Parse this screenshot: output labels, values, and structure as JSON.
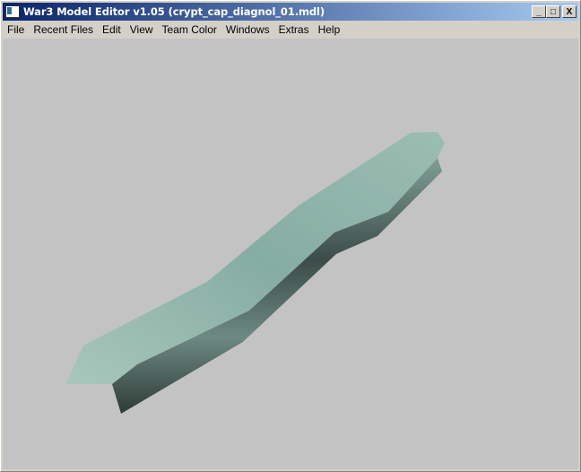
{
  "window": {
    "title": "War3 Model Editor v1.05 (crypt_cap_diagnol_01.mdl)"
  },
  "title_controls": {
    "minimize": "_",
    "maximize": "□",
    "close": "X"
  },
  "menu": [
    {
      "label": "File"
    },
    {
      "label": "Recent Files"
    },
    {
      "label": "Edit"
    },
    {
      "label": "View"
    },
    {
      "label": "Team Color"
    },
    {
      "label": "Windows"
    },
    {
      "label": "Extras"
    },
    {
      "label": "Help"
    }
  ],
  "colors": {
    "viewport_bg": "#c3c3c3",
    "model_top": "#8fb3a8",
    "model_side": "#4a5d58"
  }
}
